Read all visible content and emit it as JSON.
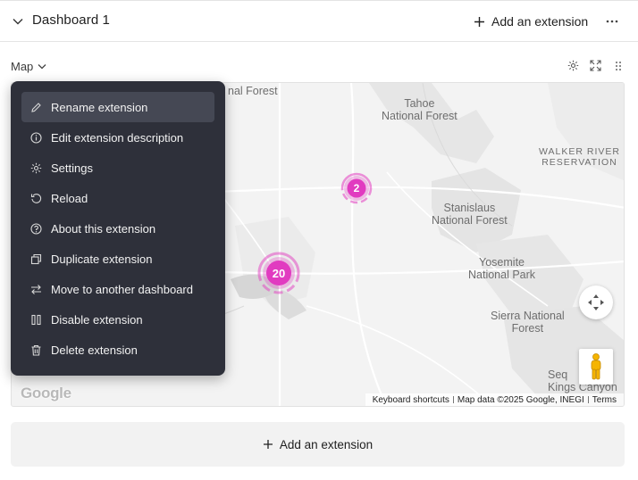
{
  "dashboard": {
    "title": "Dashboard 1",
    "add_extension_label": "Add an extension"
  },
  "extension": {
    "name": "Map",
    "tools": [
      "gear-icon",
      "expand-icon",
      "drag-handle-icon"
    ]
  },
  "menu": {
    "items": [
      {
        "label": "Rename extension",
        "icon": "pencil-icon",
        "active": true
      },
      {
        "label": "Edit extension description",
        "icon": "info-icon",
        "active": false
      },
      {
        "label": "Settings",
        "icon": "gear-icon",
        "active": false
      },
      {
        "label": "Reload",
        "icon": "reload-icon",
        "active": false
      },
      {
        "label": "About this extension",
        "icon": "question-icon",
        "active": false
      },
      {
        "label": "Duplicate extension",
        "icon": "duplicate-icon",
        "active": false
      },
      {
        "label": "Move to another dashboard",
        "icon": "swap-arrows-icon",
        "active": false
      },
      {
        "label": "Disable extension",
        "icon": "pause-icon",
        "active": false
      },
      {
        "label": "Delete extension",
        "icon": "trash-icon",
        "active": false
      }
    ]
  },
  "map": {
    "labels": {
      "forest_top": "nal Forest",
      "tahoe": "Tahoe\nNational Forest",
      "walker": "WALKER RIVER\nRESERVATION",
      "stanislaus": "Stanislaus\nNational Forest",
      "yosemite": "Yosemite\nNational Park",
      "sierra": "Sierra National\nForest",
      "sequoia": "Seq\nKings Canyon"
    },
    "clusters": [
      {
        "count": "2",
        "name": "cluster-2"
      },
      {
        "count": "20",
        "name": "cluster-20"
      }
    ],
    "cluster_color": "#e13bc0",
    "google_logo": "Google",
    "attribution": {
      "shortcuts": "Keyboard shortcuts",
      "data": "Map data ©2025 Google, INEGI",
      "terms": "Terms"
    }
  },
  "colors": {
    "menu_bg": "#2e303a",
    "menu_active": "#454854",
    "cluster": "#e13bc0"
  }
}
